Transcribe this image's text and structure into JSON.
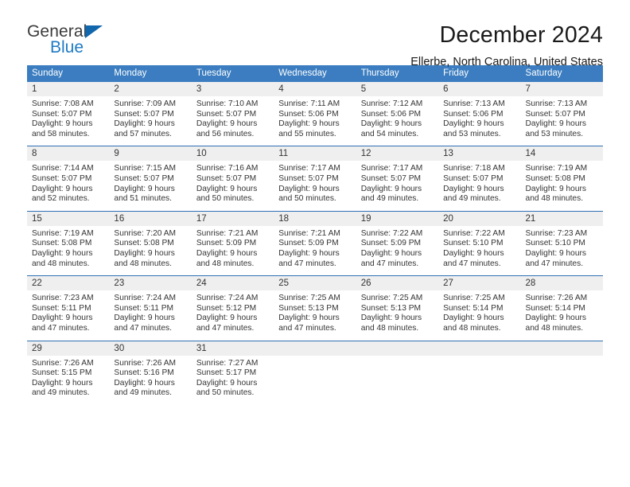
{
  "logo": {
    "line1": "General",
    "line2": "Blue",
    "triangle_color": "#1266ab",
    "blue_text_color": "#1d7ac4"
  },
  "header": {
    "title": "December 2024",
    "subtitle": "Ellerbe, North Carolina, United States"
  },
  "theme": {
    "header_bar": "#3b7dc0",
    "row_divider": "#2f6fb3",
    "daynum_background": "#efefef"
  },
  "weekday_headers": [
    "Sunday",
    "Monday",
    "Tuesday",
    "Wednesday",
    "Thursday",
    "Friday",
    "Saturday"
  ],
  "weeks": [
    [
      {
        "day": "1",
        "sunrise": "Sunrise: 7:08 AM",
        "sunset": "Sunset: 5:07 PM",
        "daylight1": "Daylight: 9 hours",
        "daylight2": "and 58 minutes."
      },
      {
        "day": "2",
        "sunrise": "Sunrise: 7:09 AM",
        "sunset": "Sunset: 5:07 PM",
        "daylight1": "Daylight: 9 hours",
        "daylight2": "and 57 minutes."
      },
      {
        "day": "3",
        "sunrise": "Sunrise: 7:10 AM",
        "sunset": "Sunset: 5:07 PM",
        "daylight1": "Daylight: 9 hours",
        "daylight2": "and 56 minutes."
      },
      {
        "day": "4",
        "sunrise": "Sunrise: 7:11 AM",
        "sunset": "Sunset: 5:06 PM",
        "daylight1": "Daylight: 9 hours",
        "daylight2": "and 55 minutes."
      },
      {
        "day": "5",
        "sunrise": "Sunrise: 7:12 AM",
        "sunset": "Sunset: 5:06 PM",
        "daylight1": "Daylight: 9 hours",
        "daylight2": "and 54 minutes."
      },
      {
        "day": "6",
        "sunrise": "Sunrise: 7:13 AM",
        "sunset": "Sunset: 5:06 PM",
        "daylight1": "Daylight: 9 hours",
        "daylight2": "and 53 minutes."
      },
      {
        "day": "7",
        "sunrise": "Sunrise: 7:13 AM",
        "sunset": "Sunset: 5:07 PM",
        "daylight1": "Daylight: 9 hours",
        "daylight2": "and 53 minutes."
      }
    ],
    [
      {
        "day": "8",
        "sunrise": "Sunrise: 7:14 AM",
        "sunset": "Sunset: 5:07 PM",
        "daylight1": "Daylight: 9 hours",
        "daylight2": "and 52 minutes."
      },
      {
        "day": "9",
        "sunrise": "Sunrise: 7:15 AM",
        "sunset": "Sunset: 5:07 PM",
        "daylight1": "Daylight: 9 hours",
        "daylight2": "and 51 minutes."
      },
      {
        "day": "10",
        "sunrise": "Sunrise: 7:16 AM",
        "sunset": "Sunset: 5:07 PM",
        "daylight1": "Daylight: 9 hours",
        "daylight2": "and 50 minutes."
      },
      {
        "day": "11",
        "sunrise": "Sunrise: 7:17 AM",
        "sunset": "Sunset: 5:07 PM",
        "daylight1": "Daylight: 9 hours",
        "daylight2": "and 50 minutes."
      },
      {
        "day": "12",
        "sunrise": "Sunrise: 7:17 AM",
        "sunset": "Sunset: 5:07 PM",
        "daylight1": "Daylight: 9 hours",
        "daylight2": "and 49 minutes."
      },
      {
        "day": "13",
        "sunrise": "Sunrise: 7:18 AM",
        "sunset": "Sunset: 5:07 PM",
        "daylight1": "Daylight: 9 hours",
        "daylight2": "and 49 minutes."
      },
      {
        "day": "14",
        "sunrise": "Sunrise: 7:19 AM",
        "sunset": "Sunset: 5:08 PM",
        "daylight1": "Daylight: 9 hours",
        "daylight2": "and 48 minutes."
      }
    ],
    [
      {
        "day": "15",
        "sunrise": "Sunrise: 7:19 AM",
        "sunset": "Sunset: 5:08 PM",
        "daylight1": "Daylight: 9 hours",
        "daylight2": "and 48 minutes."
      },
      {
        "day": "16",
        "sunrise": "Sunrise: 7:20 AM",
        "sunset": "Sunset: 5:08 PM",
        "daylight1": "Daylight: 9 hours",
        "daylight2": "and 48 minutes."
      },
      {
        "day": "17",
        "sunrise": "Sunrise: 7:21 AM",
        "sunset": "Sunset: 5:09 PM",
        "daylight1": "Daylight: 9 hours",
        "daylight2": "and 48 minutes."
      },
      {
        "day": "18",
        "sunrise": "Sunrise: 7:21 AM",
        "sunset": "Sunset: 5:09 PM",
        "daylight1": "Daylight: 9 hours",
        "daylight2": "and 47 minutes."
      },
      {
        "day": "19",
        "sunrise": "Sunrise: 7:22 AM",
        "sunset": "Sunset: 5:09 PM",
        "daylight1": "Daylight: 9 hours",
        "daylight2": "and 47 minutes."
      },
      {
        "day": "20",
        "sunrise": "Sunrise: 7:22 AM",
        "sunset": "Sunset: 5:10 PM",
        "daylight1": "Daylight: 9 hours",
        "daylight2": "and 47 minutes."
      },
      {
        "day": "21",
        "sunrise": "Sunrise: 7:23 AM",
        "sunset": "Sunset: 5:10 PM",
        "daylight1": "Daylight: 9 hours",
        "daylight2": "and 47 minutes."
      }
    ],
    [
      {
        "day": "22",
        "sunrise": "Sunrise: 7:23 AM",
        "sunset": "Sunset: 5:11 PM",
        "daylight1": "Daylight: 9 hours",
        "daylight2": "and 47 minutes."
      },
      {
        "day": "23",
        "sunrise": "Sunrise: 7:24 AM",
        "sunset": "Sunset: 5:11 PM",
        "daylight1": "Daylight: 9 hours",
        "daylight2": "and 47 minutes."
      },
      {
        "day": "24",
        "sunrise": "Sunrise: 7:24 AM",
        "sunset": "Sunset: 5:12 PM",
        "daylight1": "Daylight: 9 hours",
        "daylight2": "and 47 minutes."
      },
      {
        "day": "25",
        "sunrise": "Sunrise: 7:25 AM",
        "sunset": "Sunset: 5:13 PM",
        "daylight1": "Daylight: 9 hours",
        "daylight2": "and 47 minutes."
      },
      {
        "day": "26",
        "sunrise": "Sunrise: 7:25 AM",
        "sunset": "Sunset: 5:13 PM",
        "daylight1": "Daylight: 9 hours",
        "daylight2": "and 48 minutes."
      },
      {
        "day": "27",
        "sunrise": "Sunrise: 7:25 AM",
        "sunset": "Sunset: 5:14 PM",
        "daylight1": "Daylight: 9 hours",
        "daylight2": "and 48 minutes."
      },
      {
        "day": "28",
        "sunrise": "Sunrise: 7:26 AM",
        "sunset": "Sunset: 5:14 PM",
        "daylight1": "Daylight: 9 hours",
        "daylight2": "and 48 minutes."
      }
    ],
    [
      {
        "day": "29",
        "sunrise": "Sunrise: 7:26 AM",
        "sunset": "Sunset: 5:15 PM",
        "daylight1": "Daylight: 9 hours",
        "daylight2": "and 49 minutes."
      },
      {
        "day": "30",
        "sunrise": "Sunrise: 7:26 AM",
        "sunset": "Sunset: 5:16 PM",
        "daylight1": "Daylight: 9 hours",
        "daylight2": "and 49 minutes."
      },
      {
        "day": "31",
        "sunrise": "Sunrise: 7:27 AM",
        "sunset": "Sunset: 5:17 PM",
        "daylight1": "Daylight: 9 hours",
        "daylight2": "and 50 minutes."
      },
      {
        "day": "",
        "sunrise": "",
        "sunset": "",
        "daylight1": "",
        "daylight2": ""
      },
      {
        "day": "",
        "sunrise": "",
        "sunset": "",
        "daylight1": "",
        "daylight2": ""
      },
      {
        "day": "",
        "sunrise": "",
        "sunset": "",
        "daylight1": "",
        "daylight2": ""
      },
      {
        "day": "",
        "sunrise": "",
        "sunset": "",
        "daylight1": "",
        "daylight2": ""
      }
    ]
  ]
}
